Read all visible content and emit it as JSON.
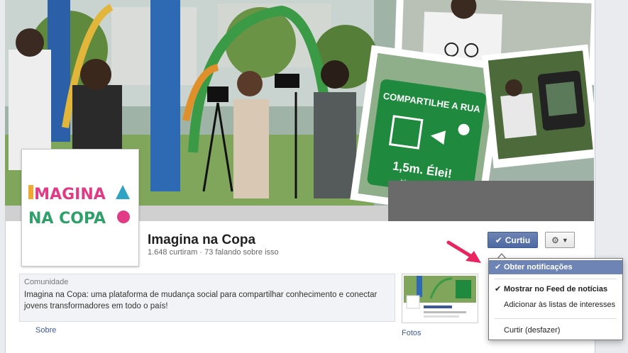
{
  "page": {
    "name": "Imagina na Copa",
    "stats": "1.648 curtiram · 73 falando sobre isso"
  },
  "profile_logo": {
    "line1": "IMAGINA",
    "line2": "NA COPA"
  },
  "cover": {
    "sign_line1": "COMPARTILHE A RUA",
    "sign_line2": "1,5m. Élei!",
    "sign_footer": "bikeanjo.com.br"
  },
  "actions": {
    "liked_label": "Curtiu",
    "liked_icon": "checkmark-icon",
    "gear_icon": "gear-icon",
    "caret_icon": "caret-down-icon"
  },
  "about": {
    "category": "Comunidade",
    "description": "Imagina na Copa: uma plataforma de mudança social para compartilhar conhecimento e conectar jovens transformadores em todo o país!",
    "about_link": "Sobre"
  },
  "photos": {
    "label": "Fotos"
  },
  "dropdown": {
    "items": [
      {
        "label": "Obter notificações",
        "checked": true
      },
      {
        "label": "Mostrar no Feed de notícias",
        "checked": true
      },
      {
        "label": "Adicionar às listas de interesses"
      },
      {
        "label": "Curtir (desfazer)"
      }
    ]
  },
  "colors": {
    "brand_blue": "#3b5998",
    "button_blue": "#5b74a8",
    "highlight": "#6d84b4",
    "arrow_pink": "#e8255e"
  }
}
